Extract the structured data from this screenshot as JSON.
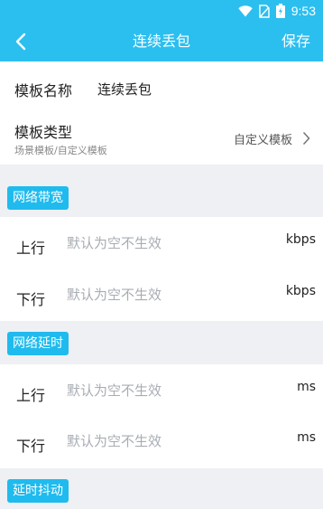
{
  "status_bar": {
    "time": "9:53",
    "icons": [
      "wifi-icon",
      "sim-icon",
      "battery-icon"
    ]
  },
  "app_bar": {
    "title": "连续丢包",
    "action_label": "保存",
    "back_icon": "back-arrow-icon"
  },
  "template_name": {
    "label": "模板名称",
    "value": "连续丢包"
  },
  "template_type": {
    "label": "模板类型",
    "sublabel": "场景模板/自定义模板",
    "value": "自定义模板",
    "icon": "chevron-right-icon"
  },
  "sections": [
    {
      "title": "网络带宽",
      "rows": [
        {
          "label": "上行",
          "placeholder": "默认为空不生效",
          "value": "",
          "unit": "kbps"
        },
        {
          "label": "下行",
          "placeholder": "默认为空不生效",
          "value": "",
          "unit": "kbps"
        }
      ]
    },
    {
      "title": "网络延时",
      "rows": [
        {
          "label": "上行",
          "placeholder": "默认为空不生效",
          "value": "",
          "unit": "ms"
        },
        {
          "label": "下行",
          "placeholder": "默认为空不生效",
          "value": "",
          "unit": "ms"
        }
      ]
    },
    {
      "title": "延时抖动"
    }
  ],
  "colors": {
    "accent": "#2bbff0",
    "chip": "#1fbbee",
    "background": "#eef0f3",
    "card": "#ffffff",
    "placeholder": "#a8adb3"
  }
}
